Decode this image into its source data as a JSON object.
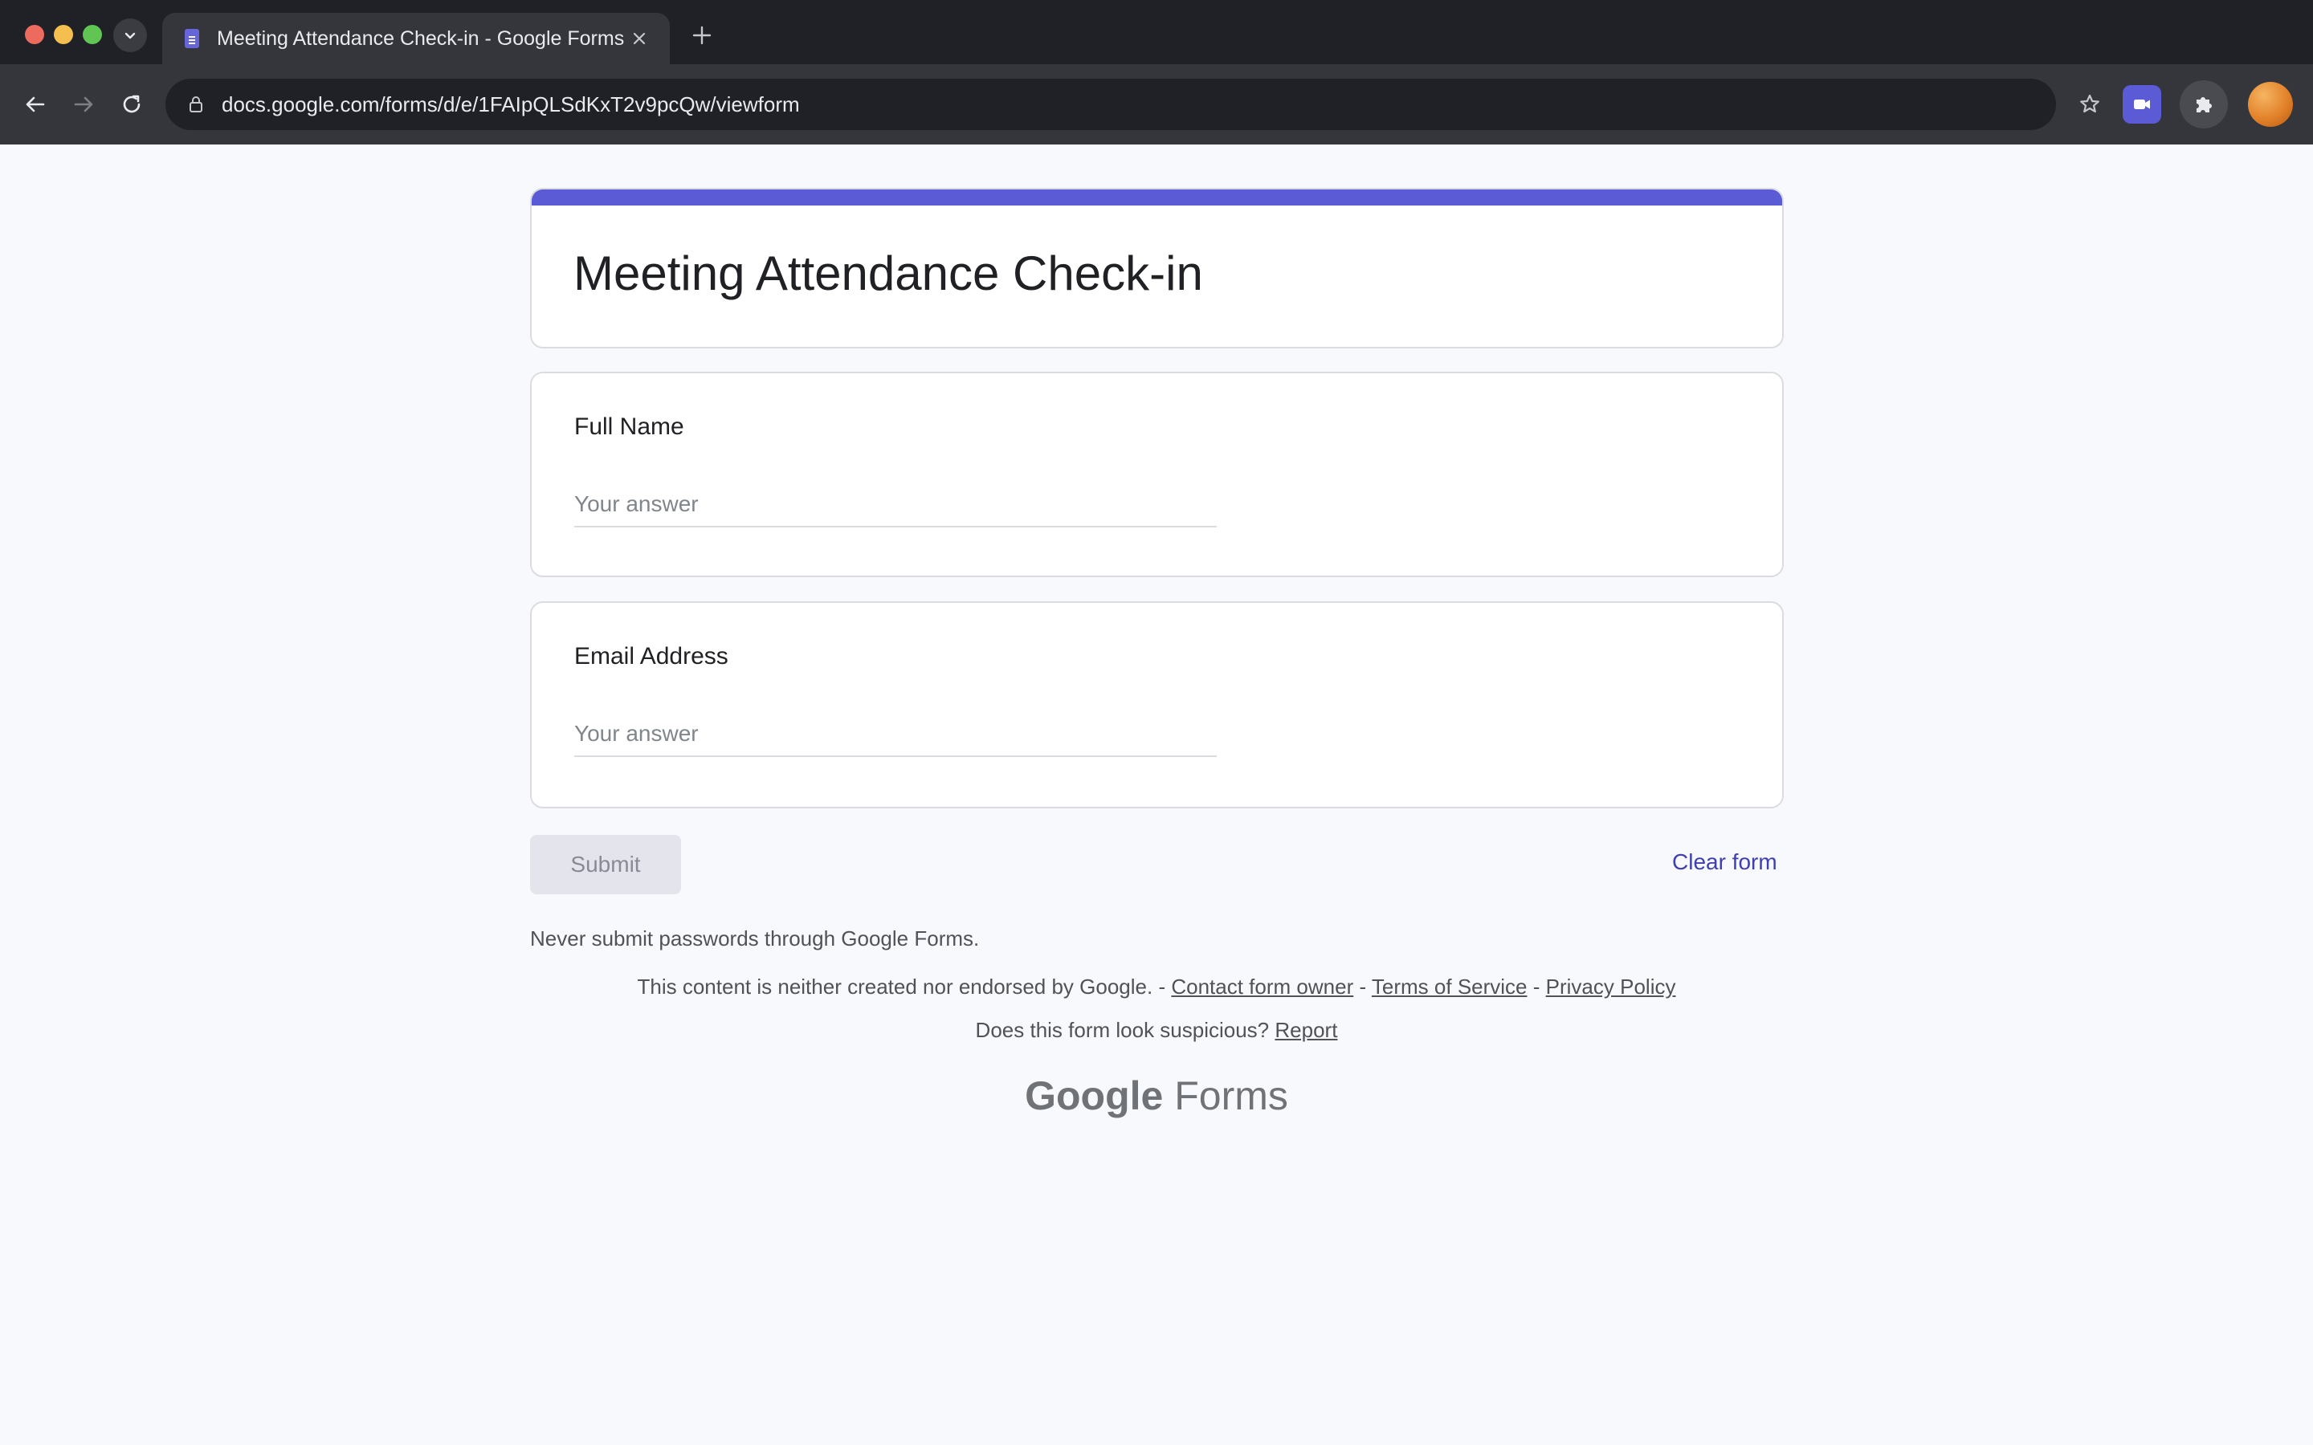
{
  "browser": {
    "tab": {
      "title": "Meeting Attendance Check-in - Google Forms"
    },
    "url": "docs.google.com/forms/d/e/1FAIpQLSdKxT2v9pcQw/viewform",
    "icons": {
      "back": "arrow-left-icon",
      "forward": "arrow-right-icon",
      "reload": "reload-icon",
      "lock": "lock-icon",
      "star": "star-icon",
      "extension_meet": "video-camera-icon",
      "extensions": "puzzle-icon"
    }
  },
  "colors": {
    "accent": "#5b5bd6",
    "link": "#3f3fb0",
    "page_bg": "#f8f9fc"
  },
  "form": {
    "title": "Meeting Attendance Check-in",
    "questions": [
      {
        "label": "Full Name",
        "placeholder": "Your answer"
      },
      {
        "label": "Email Address",
        "placeholder": "Your answer"
      }
    ],
    "submit_label": "Submit",
    "clear_label": "Clear form"
  },
  "footer": {
    "never_submit": "Never submit passwords through Google Forms.",
    "disclaimer_text": "This content is neither created nor endorsed by Google.",
    "separator": "-",
    "contact_owner": "Contact form owner",
    "terms": "Terms of Service",
    "privacy": "Privacy Policy",
    "suspicious_text": "Does this form look suspicious?",
    "report": "Report",
    "brand_google": "Google",
    "brand_forms": "Forms"
  }
}
